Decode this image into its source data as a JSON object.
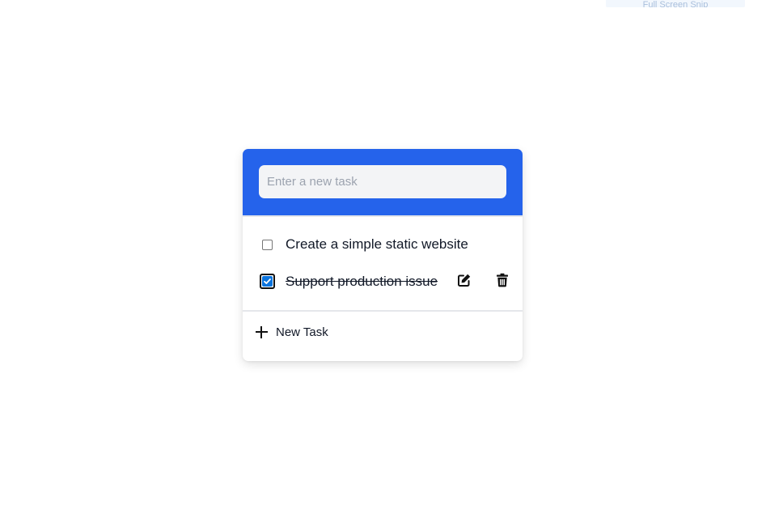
{
  "top_chip": {
    "label": "Full Screen Snip"
  },
  "todo": {
    "input": {
      "placeholder": "Enter a new task",
      "value": ""
    },
    "tasks": [
      {
        "text": "Create a simple static website",
        "done": false
      },
      {
        "text": "Support production issue",
        "done": true
      }
    ],
    "new_task_label": "New Task",
    "icons": {
      "edit": "edit-icon",
      "delete": "trash-icon",
      "add": "plus-icon"
    }
  },
  "colors": {
    "header": "#2563eb",
    "input_bg": "#f3f4f6",
    "checkbox_checked": "#0b74de"
  }
}
